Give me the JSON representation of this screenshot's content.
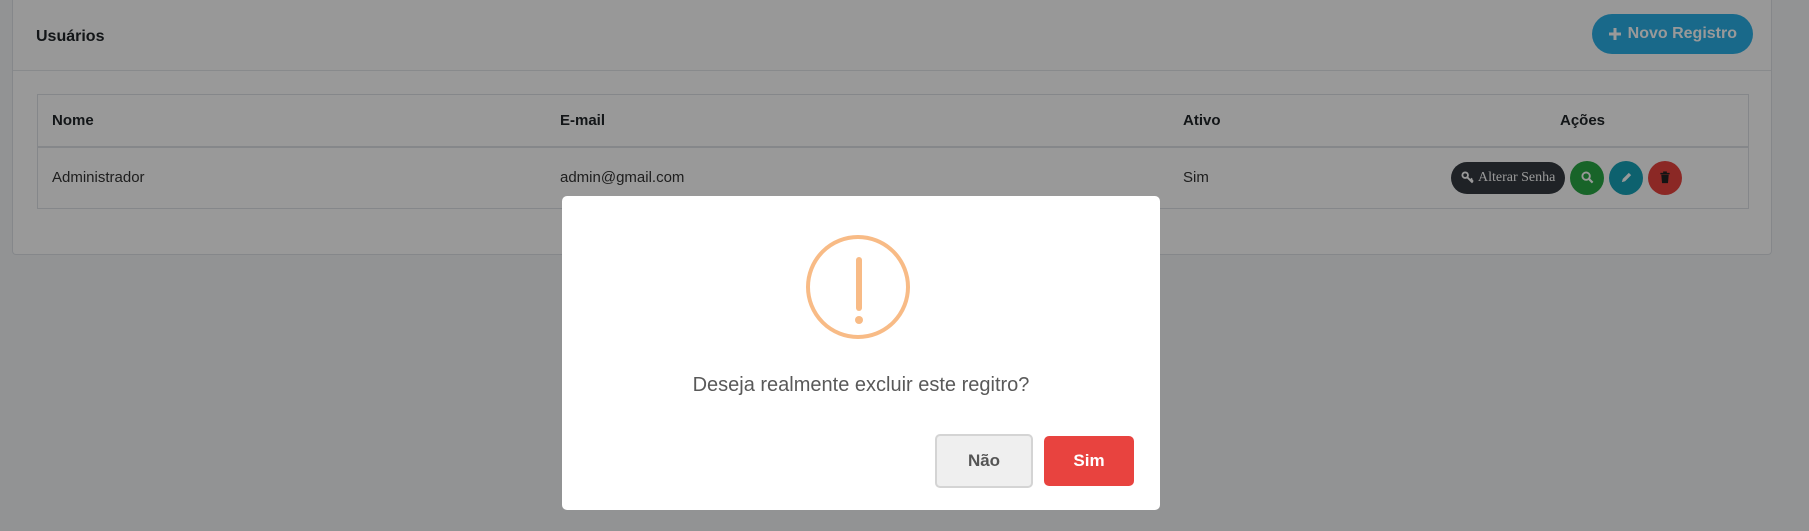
{
  "card": {
    "title": "Usuários",
    "new_button_label": "Novo Registro"
  },
  "table": {
    "headers": [
      "Nome",
      "E-mail",
      "Ativo",
      "Ações"
    ],
    "rows": [
      {
        "nome": "Administrador",
        "email": "admin@gmail.com",
        "ativo": "Sim",
        "change_password_label": "Alterar Senha"
      }
    ]
  },
  "modal": {
    "icon": "warning-icon",
    "message": "Deseja realmente excluir este regitro?",
    "no_label": "Não",
    "yes_label": "Sim"
  },
  "colors": {
    "primary": "#2bafe6",
    "view": "#28a745",
    "edit": "#17a2b8",
    "delete": "#e8433f",
    "dark": "#343a40",
    "warning": "#f8bb86"
  },
  "icons": {
    "plus": "plus-icon",
    "key": "key-icon",
    "search": "search-icon",
    "pencil": "pencil-icon",
    "trash": "trash-icon"
  }
}
